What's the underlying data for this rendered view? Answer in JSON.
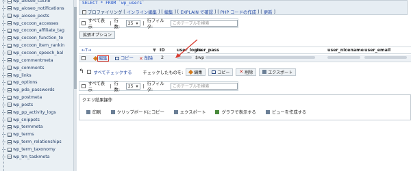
{
  "sidebar": {
    "items": [
      "wp_aioseo_cache",
      "wp_aioseo_notifications",
      "wp_aioseo_posts",
      "wp_cocoon_accesses",
      "wp_cocoon_affiliate_tag",
      "wp_cocoon_function_te",
      "wp_cocoon_item_rankin",
      "wp_cocoon_speech_bal",
      "wp_commentmeta",
      "wp_comments",
      "wp_links",
      "wp_options",
      "wp_pda_passwords",
      "wp_postmeta",
      "wp_posts",
      "wp_pp_activity_logs",
      "wp_snippets",
      "wp_termmeta",
      "wp_terms",
      "wp_term_relationships",
      "wp_term_taxonomy",
      "wp_tm_taskmeta"
    ]
  },
  "sql": {
    "query": "SELECT * FROM `wp_users`",
    "profiling": "プロファイリング",
    "links": [
      "インライン編集",
      "編集",
      "EXPLAIN で確認",
      "PHP コードの作成",
      "更新"
    ]
  },
  "controls": {
    "show_all": "すべて表示",
    "rows_label": "行数:",
    "rows_value": "25",
    "filter_label": "行フィルタ:",
    "filter_placeholder": "このテーブルを検索"
  },
  "extra_options": "拡張オプション",
  "table": {
    "sort_arrows": "←T→",
    "headers": [
      "ID",
      "user_login",
      "user_pass",
      "user_nicename",
      "user_email"
    ],
    "row": {
      "edit": "編集",
      "copy": "コピー",
      "delete": "削除",
      "id": "2",
      "pass_prefix": "$wp"
    }
  },
  "bulk": {
    "check_all": "すべてチェックする",
    "with_selected": "チェックしたものを:",
    "edit": "編集",
    "copy": "コピー",
    "delete": "削除",
    "export": "エクスポート"
  },
  "query_ops": {
    "title": "クエリ結果操作",
    "items": [
      "印刷",
      "クリップボードにコピー",
      "エクスポート",
      "グラフで表示する",
      "ビューを作成する"
    ]
  }
}
